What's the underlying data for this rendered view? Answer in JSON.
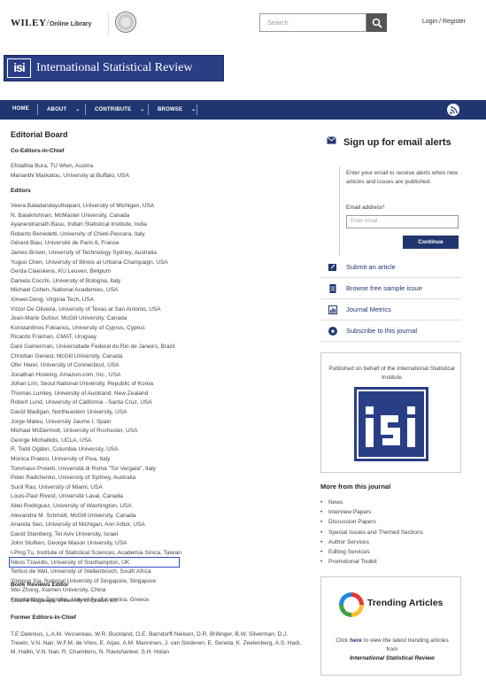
{
  "header": {
    "brand": "WILEY",
    "brand_sub": "Online Library",
    "search_placeholder": "Search",
    "login_label": "Login / Register"
  },
  "journal": {
    "logo_text": "isi",
    "title": "International Statistical Review"
  },
  "nav": {
    "home": "HOME",
    "about": "ABOUT",
    "contribute": "CONTRIBUTE",
    "browse": "BROWSE"
  },
  "main": {
    "heading": "Editorial Board",
    "coeditors_heading": "Co-Editors-in-Chief",
    "coeditors": [
      "Efstathia Bura, TU Wien, Austria",
      "Marianthi Markatou, University at Buffalo, USA"
    ],
    "editors_heading": "Editors",
    "editors": [
      "Veera Baladandayuthapani, University of Michigan, USA",
      "N. Balakrishnan, McMaster University, Canada",
      "Ayanendranath Basu, Indian Statistical Institute, India",
      "Roberto Benedetti, University of Chieti-Pescara, Italy",
      "Gérard Biau, Université de Paris 6, France",
      "James Brown, University of Technology Sydney, Australia",
      "Yuguo Chen, University of Illinois at Urbana-Champaign, USA",
      "Gerda Claeskens, KU Leuven, Belgium",
      "Daniela Cocchi, University of Bologna, Italy",
      "Michael Cohen, National Academies, USA",
      "Xinwei Deng, Virginia Tech, USA",
      "Victor De Oliveira, University of Texas at San Antonio, USA",
      "Jean-Marie Dufour, McGill University, Canada",
      "Konstantinos Fokianos, University of Cyprus, Cyprus",
      "Ricardo Fraiman, CMAT, Uruguay",
      "Dani Gamerman, Universidade Federal do Rio de Janeiro, Brazil",
      "Christian Genest, McGill University, Canada",
      "Ofer Harel, University of Connecticut, USA",
      "Jonathan Hosking, Amazon.com, Inc., USA",
      "Johan Lim, Seoul National University, Republic of Korea",
      "Thomas Lumley, University of Auckland, New Zealand",
      "Robert Lund, University of California - Santa Cruz, USA",
      "David Madigan, Northeastern University, USA",
      "Jorge Mateu, University Jaume I, Spain",
      "Michael McDermott, University of Rochester, USA",
      "George Michailidis, UCLA, USA",
      "R. Todd Ogden, Columbia University, USA",
      "Monica Pratesi, University of Pisa, Italy",
      "Tommaso Proietti, Università di Roma \"Tor Vergata\", Italy",
      "Peter Radchenko, University of Sydney, Australia",
      "Sunil Rao, University of Miami, USA",
      "Louis-Paul Rivest, Université Laval, Canada",
      "Abel Rodriguez, University of Washington, USA",
      "Alexandra M. Schmidt, McGill University, Canada",
      "Ananda Sen, University of Michigan, Ann Arbor, USA",
      "David Steinberg, Tel Aviv University, Israel",
      "John Stufken, George Mason University, USA",
      "I-Ping Tu, Institute of Statistical Sciences, Academia Sinica, Taiwan",
      "Nikos Tzavidis, University of Southampton, UK",
      "Tertius de Wet, University of Stellenbosch, South Africa",
      "Yingcun Xia, National University of Singapore, Singapore",
      "Wei Zhong, Xiamen University, China",
      "Konstantinos Zografos, University of Ioannina, Greece"
    ],
    "book_reviews_heading": "Book Reviews Editor",
    "book_reviews_editor": "Chaitra Nagaraja, University of Exeter, UK",
    "former_heading": "Former Editors-in-Chief",
    "former_text": "T.E Dalenius, L.A.M. Vessereau, W.R. Buckland, O.E. Barndorff-Nielsen, D.R. Brillinger, B.W. Silverman, D.J. Trewin, V.N. Nair, W.F.M. de Vries, E. Arjas, A.M. Manninen, J. van Sinderen, E. Seneta, K. Zeelenberg, A.S. Hadi, M. Hallin, V.N. Nair, R. Chambers, N. Ravishanker, S.H. Holan"
  },
  "sidebar": {
    "signup_title": "Sign up for email alerts",
    "signup_desc": "Enter your email to receive alerts when new articles and issues are published.",
    "email_label": "Email address*",
    "email_placeholder": "Enter email",
    "continue_label": "Continue",
    "links": [
      {
        "label": "Submit an article",
        "icon": "edit-icon"
      },
      {
        "label": "Browse free sample issue",
        "icon": "document-icon"
      },
      {
        "label": "Journal Metrics",
        "icon": "chart-icon"
      },
      {
        "label": "Subscribe to this journal",
        "icon": "plus-circle-icon"
      }
    ],
    "published_text": "Published on behalf of the International Statistical Institute",
    "isi_logo_text": "isi",
    "more_heading": "More from this journal",
    "more_items": [
      "News",
      "Interview Papers",
      "Discussion Papers",
      "Special Issues and Themed Sections",
      "Author Services",
      "Editing Services",
      "Promotional Toolkit"
    ],
    "trending_title": "Trending Articles",
    "trending_pre": "Click ",
    "trending_link": "here",
    "trending_post": " to view the latest trending articles from",
    "trending_journal": "International Statistical Review"
  },
  "colors": {
    "navy": "#20366f",
    "journal_blue": "#2a3e86",
    "highlight_border": "#2a50c8"
  }
}
